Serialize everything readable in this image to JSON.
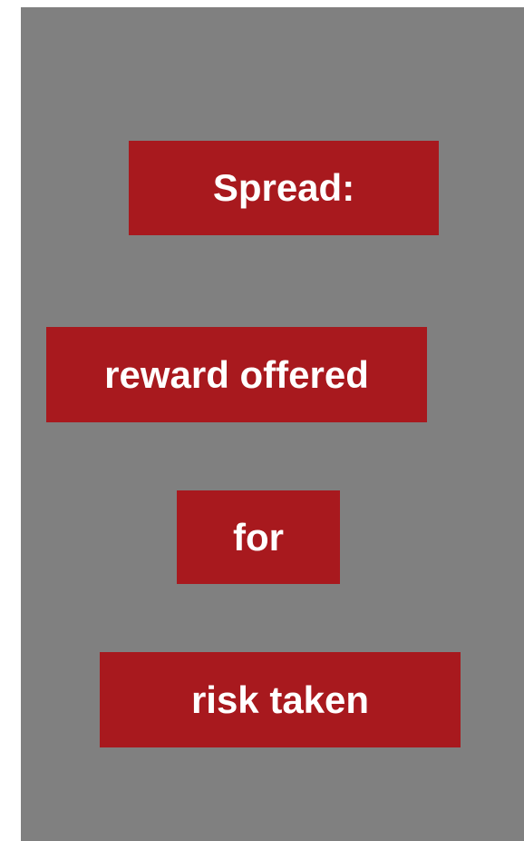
{
  "colors": {
    "background": "#808080",
    "box_fill": "#A8191E",
    "text": "#FFFFFF"
  },
  "boxes": [
    {
      "text": "Spread:"
    },
    {
      "text": "reward offered"
    },
    {
      "text": "for"
    },
    {
      "text": "risk taken"
    }
  ]
}
